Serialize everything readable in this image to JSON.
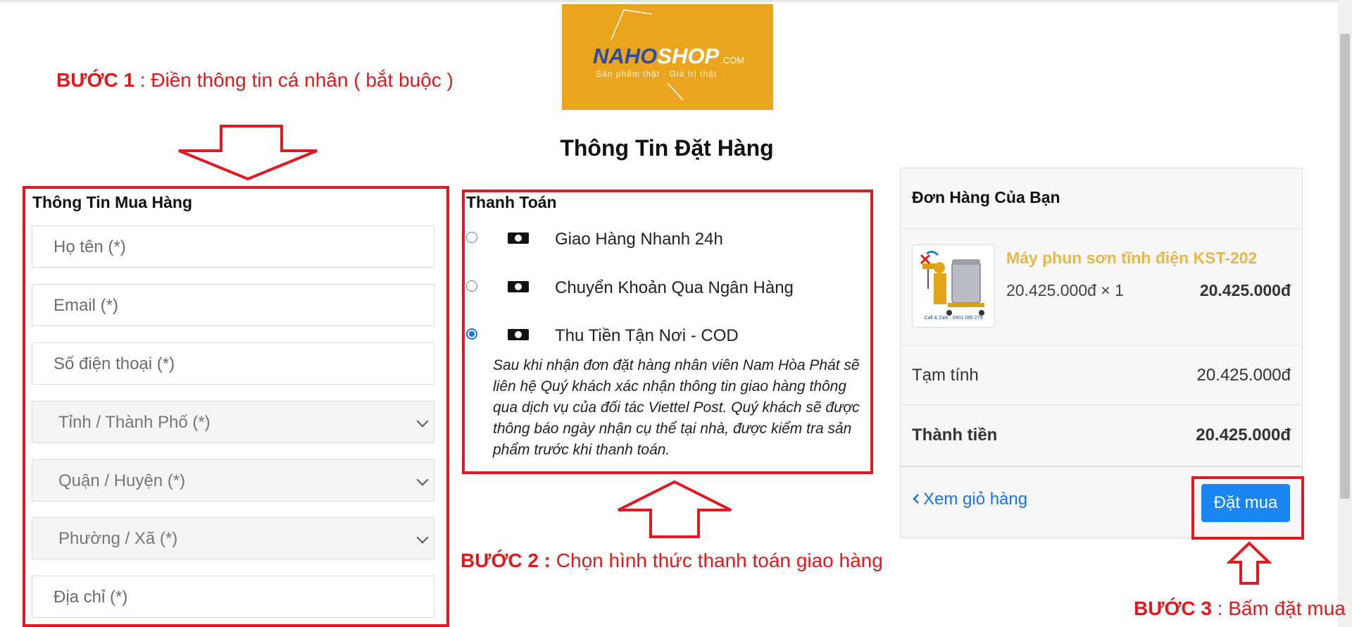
{
  "logo": {
    "naho": "NAHO",
    "shop": "SHOP",
    "com": ".COM",
    "tagline": "Sản phẩm thật - Giá trị thật"
  },
  "annotations": {
    "step1": {
      "label": "BƯỚC 1",
      "text": " : Điền thông tin cá nhân ( bắt buộc )"
    },
    "step2": {
      "label": "BƯỚC 2 :",
      "text": " Chọn hình thức thanh toán giao hàng"
    },
    "step3": {
      "label": "BƯỚC 3",
      "text": " : Bấm đặt mua"
    }
  },
  "page_title": "Thông Tin Đặt Hàng",
  "buyer": {
    "title": "Thông Tin Mua Hàng",
    "name_placeholder": "Họ tên (*)",
    "email_placeholder": "Email (*)",
    "phone_placeholder": "Số điện thoại (*)",
    "province_selected": "Tỉnh / Thành Phố (*)",
    "district_selected": "Quận / Huyện (*)",
    "ward_selected": "Phường / Xã (*)",
    "address_placeholder": "Địa chỉ (*)"
  },
  "payment": {
    "title": "Thanh Toán",
    "options": [
      {
        "label": "Giao Hàng Nhanh 24h",
        "selected": false
      },
      {
        "label": "Chuyển Khoản Qua Ngân Hàng",
        "selected": false
      },
      {
        "label": "Thu Tiền Tận Nơi - COD",
        "selected": true
      }
    ],
    "description": "Sau khi nhận đơn đặt hàng nhân viên Nam Hòa Phát sẽ liên hệ Quý khách xác nhận thông tin giao hàng thông qua dịch vụ của đối tác Viettel Post. Quý khách sẽ được thông báo ngày nhận cụ thể tại nhà, được kiểm tra sản phẩm trước khi thanh toán."
  },
  "order": {
    "title": "Đơn Hàng Của Bạn",
    "product": {
      "name": "Máy phun sơn tĩnh điện KST-202",
      "qty_line": "20.425.000đ × 1",
      "line_total": "20.425.000đ",
      "image_caption": "Call & Zalo : 0901 095 279"
    },
    "subtotal_label": "Tạm tính",
    "subtotal_value": "20.425.000đ",
    "total_label": "Thành tiền",
    "total_value": "20.425.000đ",
    "back_link": "Xem giỏ hàng",
    "back_icon": "chevron-left-icon",
    "order_button": "Đặt mua"
  },
  "colors": {
    "annotation_red": "#e01a1a",
    "accent_blue": "#1a86f1",
    "logo_orange": "#eba41e",
    "product_gold": "#e5b84e"
  }
}
